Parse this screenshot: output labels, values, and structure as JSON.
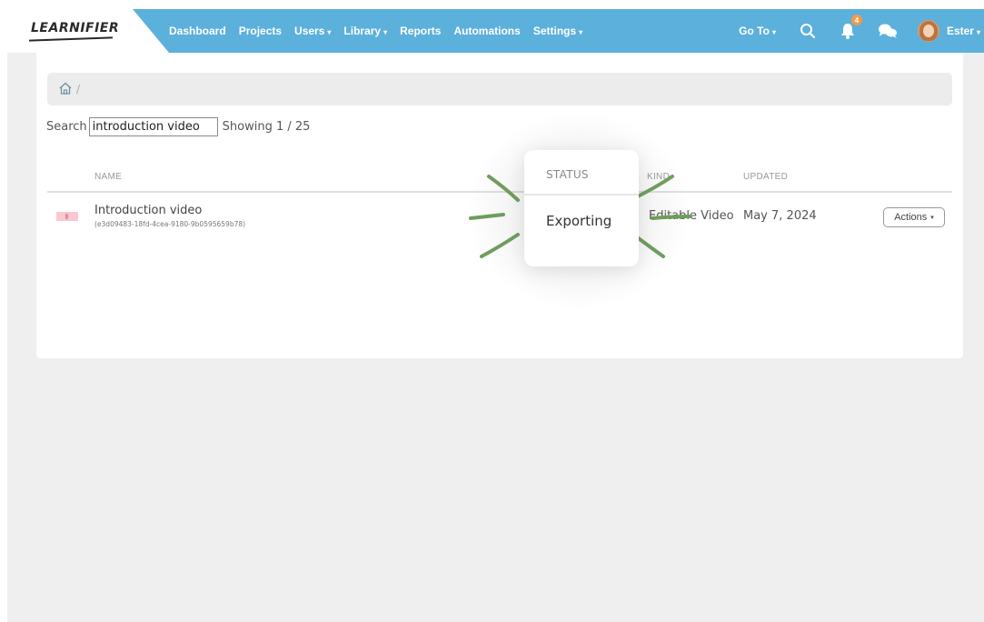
{
  "brand": {
    "logo_text": "LEARNIFIER"
  },
  "nav": {
    "items": [
      {
        "label": "Dashboard",
        "dropdown": false
      },
      {
        "label": "Projects",
        "dropdown": false
      },
      {
        "label": "Users",
        "dropdown": true
      },
      {
        "label": "Library",
        "dropdown": true
      },
      {
        "label": "Reports",
        "dropdown": false
      },
      {
        "label": "Automations",
        "dropdown": false
      },
      {
        "label": "Settings",
        "dropdown": true
      }
    ],
    "caret": "▾"
  },
  "header_right": {
    "goto_label": "Go To",
    "notification_count": "4",
    "user_name": "Ester"
  },
  "breadcrumb": {
    "separator": "/"
  },
  "search": {
    "label": "Search",
    "value": "introduction video",
    "showing": "Showing 1 / 25"
  },
  "table": {
    "headers": {
      "name": "NAME",
      "kind": "KIND",
      "updated": "UPDATED"
    },
    "rows": [
      {
        "name": "Introduction video",
        "id": "(e3d09483-18fd-4cea-9180-9b0595659b78)",
        "status": "Exporting",
        "kind": "Editable Video",
        "updated": "May 7, 2024",
        "actions_label": "Actions"
      }
    ]
  },
  "status_popout": {
    "header": "STATUS",
    "value": "Exporting"
  },
  "colors": {
    "header_bg": "#5cb0dc",
    "page_bg": "#efefef",
    "badge": "#f39a4a",
    "sparkle": "#6e9e5e"
  },
  "icons": {
    "home": "home-icon",
    "search": "search-icon",
    "bell": "bell-icon",
    "chat": "chat-icon"
  }
}
